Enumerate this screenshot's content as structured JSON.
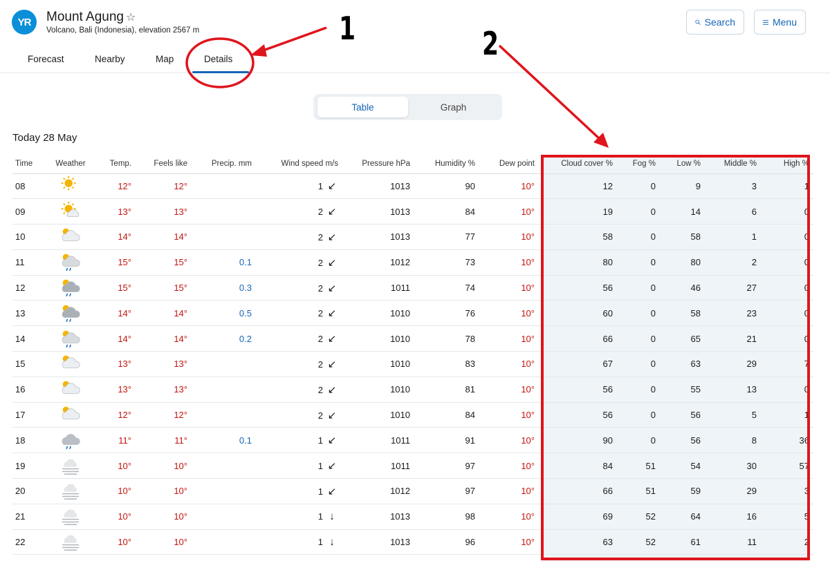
{
  "header": {
    "logo_text": "YR",
    "title": "Mount Agung",
    "star_icon": "☆",
    "subtitle": "Volcano, Bali (Indonesia), elevation 2567 m",
    "search_label": "Search",
    "menu_label": "Menu"
  },
  "tabs": [
    {
      "label": "Forecast"
    },
    {
      "label": "Nearby"
    },
    {
      "label": "Map"
    },
    {
      "label": "Details",
      "active": true
    }
  ],
  "view_toggle": {
    "table_label": "Table",
    "graph_label": "Graph",
    "selected": "Table"
  },
  "date_heading": "Today 28 May",
  "columns": [
    "Time",
    "Weather",
    "Temp.",
    "Feels like",
    "Precip. mm",
    "Wind speed m/s",
    "Pressure hPa",
    "Humidity %",
    "Dew point",
    "Cloud cover %",
    "Fog %",
    "Low %",
    "Middle %",
    "High %"
  ],
  "rows": [
    {
      "time": "08",
      "weather": "sun-icon",
      "temp": "12°",
      "feels": "12°",
      "precip": "",
      "wind": "1",
      "wind_dir": "↙",
      "pressure": "1013",
      "humidity": "90",
      "dew": "10°",
      "cloud": "12",
      "fog": "0",
      "low": "9",
      "middle": "3",
      "high": "1"
    },
    {
      "time": "09",
      "weather": "sun-cloud-icon",
      "temp": "13°",
      "feels": "13°",
      "precip": "",
      "wind": "2",
      "wind_dir": "↙",
      "pressure": "1013",
      "humidity": "84",
      "dew": "10°",
      "cloud": "19",
      "fog": "0",
      "low": "14",
      "middle": "6",
      "high": "0"
    },
    {
      "time": "10",
      "weather": "partly-cloudy-icon",
      "temp": "14°",
      "feels": "14°",
      "precip": "",
      "wind": "2",
      "wind_dir": "↙",
      "pressure": "1013",
      "humidity": "77",
      "dew": "10°",
      "cloud": "58",
      "fog": "0",
      "low": "58",
      "middle": "1",
      "high": "0"
    },
    {
      "time": "11",
      "weather": "light-rain-sun-icon",
      "temp": "15°",
      "feels": "15°",
      "precip": "0.1",
      "wind": "2",
      "wind_dir": "↙",
      "pressure": "1012",
      "humidity": "73",
      "dew": "10°",
      "cloud": "80",
      "fog": "0",
      "low": "80",
      "middle": "2",
      "high": "0"
    },
    {
      "time": "12",
      "weather": "rain-sun-icon",
      "temp": "15°",
      "feels": "15°",
      "precip": "0.3",
      "wind": "2",
      "wind_dir": "↙",
      "pressure": "1011",
      "humidity": "74",
      "dew": "10°",
      "cloud": "56",
      "fog": "0",
      "low": "46",
      "middle": "27",
      "high": "0"
    },
    {
      "time": "13",
      "weather": "rain-sun-icon",
      "temp": "14°",
      "feels": "14°",
      "precip": "0.5",
      "wind": "2",
      "wind_dir": "↙",
      "pressure": "1010",
      "humidity": "76",
      "dew": "10°",
      "cloud": "60",
      "fog": "0",
      "low": "58",
      "middle": "23",
      "high": "0"
    },
    {
      "time": "14",
      "weather": "light-rain-sun-icon",
      "temp": "14°",
      "feels": "14°",
      "precip": "0.2",
      "wind": "2",
      "wind_dir": "↙",
      "pressure": "1010",
      "humidity": "78",
      "dew": "10°",
      "cloud": "66",
      "fog": "0",
      "low": "65",
      "middle": "21",
      "high": "0"
    },
    {
      "time": "15",
      "weather": "partly-cloudy-icon",
      "temp": "13°",
      "feels": "13°",
      "precip": "",
      "wind": "2",
      "wind_dir": "↙",
      "pressure": "1010",
      "humidity": "83",
      "dew": "10°",
      "cloud": "67",
      "fog": "0",
      "low": "63",
      "middle": "29",
      "high": "7"
    },
    {
      "time": "16",
      "weather": "partly-cloudy-icon",
      "temp": "13°",
      "feels": "13°",
      "precip": "",
      "wind": "2",
      "wind_dir": "↙",
      "pressure": "1010",
      "humidity": "81",
      "dew": "10°",
      "cloud": "56",
      "fog": "0",
      "low": "55",
      "middle": "13",
      "high": "0"
    },
    {
      "time": "17",
      "weather": "partly-cloudy-icon",
      "temp": "12°",
      "feels": "12°",
      "precip": "",
      "wind": "2",
      "wind_dir": "↙",
      "pressure": "1010",
      "humidity": "84",
      "dew": "10°",
      "cloud": "56",
      "fog": "0",
      "low": "56",
      "middle": "5",
      "high": "1"
    },
    {
      "time": "18",
      "weather": "light-rain-icon",
      "temp": "11°",
      "feels": "11°",
      "precip": "0.1",
      "wind": "1",
      "wind_dir": "↙",
      "pressure": "1011",
      "humidity": "91",
      "dew": "10°",
      "cloud": "90",
      "fog": "0",
      "low": "56",
      "middle": "8",
      "high": "36"
    },
    {
      "time": "19",
      "weather": "fog-icon",
      "temp": "10°",
      "feels": "10°",
      "precip": "",
      "wind": "1",
      "wind_dir": "↙",
      "pressure": "1011",
      "humidity": "97",
      "dew": "10°",
      "cloud": "84",
      "fog": "51",
      "low": "54",
      "middle": "30",
      "high": "57"
    },
    {
      "time": "20",
      "weather": "fog-icon",
      "temp": "10°",
      "feels": "10°",
      "precip": "",
      "wind": "1",
      "wind_dir": "↙",
      "pressure": "1012",
      "humidity": "97",
      "dew": "10°",
      "cloud": "66",
      "fog": "51",
      "low": "59",
      "middle": "29",
      "high": "3"
    },
    {
      "time": "21",
      "weather": "fog-icon",
      "temp": "10°",
      "feels": "10°",
      "precip": "",
      "wind": "1",
      "wind_dir": "↓",
      "pressure": "1013",
      "humidity": "98",
      "dew": "10°",
      "cloud": "69",
      "fog": "52",
      "low": "64",
      "middle": "16",
      "high": "5"
    },
    {
      "time": "22",
      "weather": "fog-icon",
      "temp": "10°",
      "feels": "10°",
      "precip": "",
      "wind": "1",
      "wind_dir": "↓",
      "pressure": "1013",
      "humidity": "96",
      "dew": "10°",
      "cloud": "63",
      "fog": "52",
      "low": "61",
      "middle": "11",
      "high": "2"
    }
  ],
  "annotations": {
    "label_1": "1",
    "label_2": "2",
    "color": "#e0141c"
  },
  "colors": {
    "accent": "#1565b8",
    "temperature": "#c3140e",
    "precipitation": "#1565b8",
    "logo": "#0a8fd8"
  }
}
